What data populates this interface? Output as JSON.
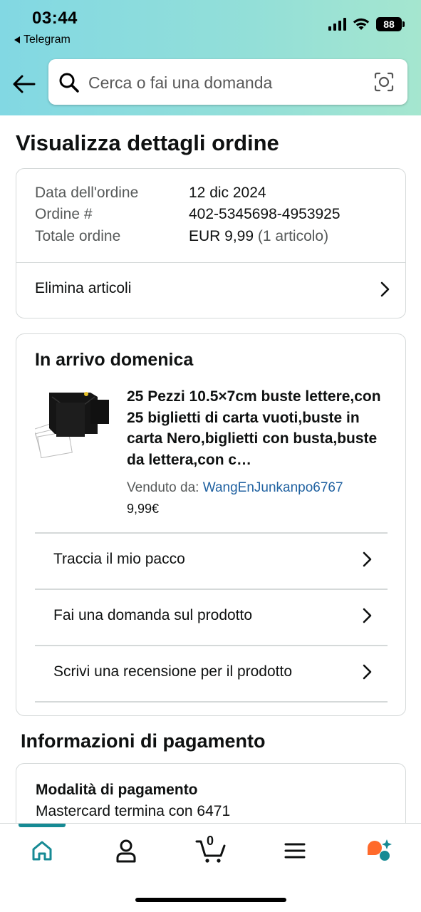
{
  "status_bar": {
    "time": "03:44",
    "back_app": "Telegram",
    "battery": "88"
  },
  "search": {
    "placeholder": "Cerca o fai una domanda"
  },
  "page_title": "Visualizza dettagli ordine",
  "order_summary": {
    "date_label": "Data dell'ordine",
    "date_value": "12 dic 2024",
    "order_label": "Ordine #",
    "order_value": "402-5345698-4953925",
    "total_label": "Totale ordine",
    "total_value": "EUR 9,99",
    "total_items": "(1 articolo)",
    "delete_items": "Elimina articoli"
  },
  "shipment": {
    "arrival_title": "In arrivo domenica",
    "product_title": "25 Pezzi 10.5×7cm buste lettere,con 25 biglietti di carta vuoti,buste in carta Nero,biglietti con busta,buste da lettera,con c…",
    "sold_by_label": "Venduto da:",
    "seller": "WangEnJunkanpo6767",
    "price": "9,99€",
    "actions": [
      "Traccia il mio pacco",
      "Fai una domanda sul prodotto",
      "Scrivi una recensione per il prodotto"
    ]
  },
  "payment": {
    "section_title": "Informazioni di pagamento",
    "method_label": "Modalità di pagamento",
    "method_value": "Mastercard termina con 6471"
  },
  "bottom_nav": {
    "cart_count": "0",
    "items": [
      "home-icon",
      "account-icon",
      "cart-icon",
      "menu-icon",
      "rufus-ai-icon"
    ]
  },
  "colors": {
    "header_gradient_start": "#82d8e3",
    "header_gradient_end": "#a5e6cf",
    "link": "#2162a1",
    "nav_active": "#168a94"
  }
}
